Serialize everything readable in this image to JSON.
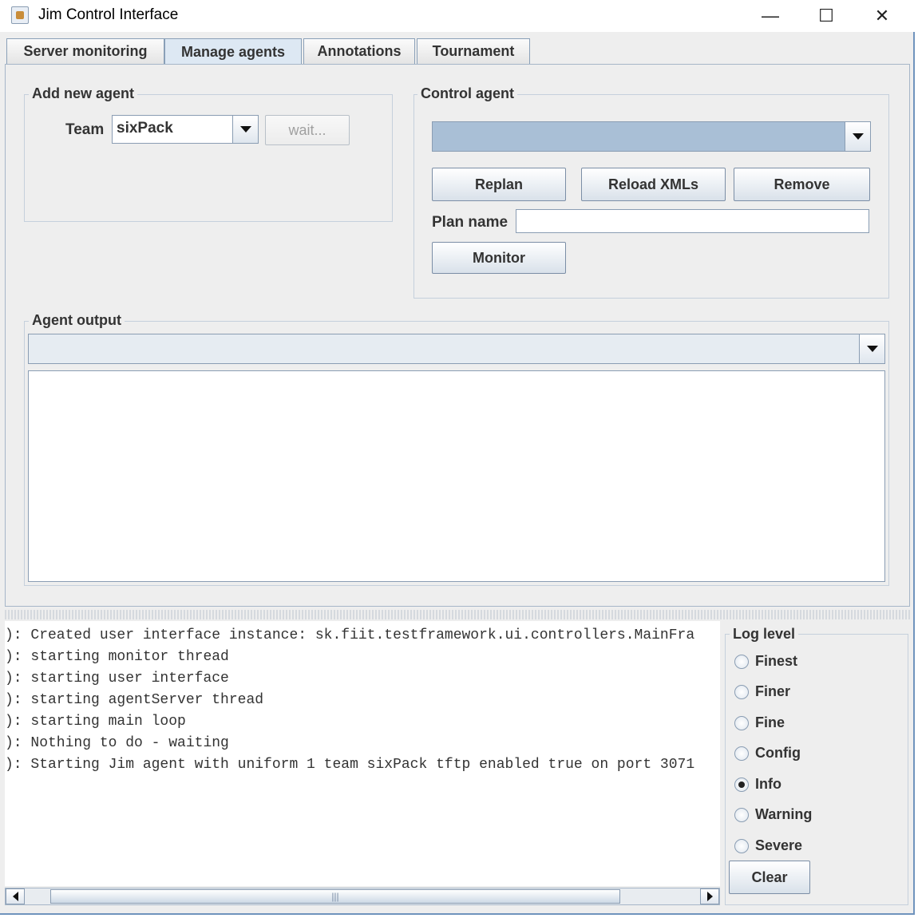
{
  "window": {
    "title": "Jim Control Interface",
    "minimize_glyph": "—",
    "maximize_glyph": "☐",
    "close_glyph": "✕"
  },
  "tabs": [
    {
      "label": "Server monitoring"
    },
    {
      "label": "Manage agents",
      "selected": true
    },
    {
      "label": "Annotations"
    },
    {
      "label": "Tournament"
    }
  ],
  "add_agent": {
    "legend": "Add new agent",
    "team_label": "Team",
    "team_value": "sixPack",
    "wait_button": "wait..."
  },
  "control_agent": {
    "legend": "Control agent",
    "agent_select_value": "",
    "replan_button": "Replan",
    "reload_button": "Reload XMLs",
    "remove_button": "Remove",
    "plan_name_label": "Plan name",
    "plan_name_value": "",
    "monitor_button": "Monitor"
  },
  "agent_output": {
    "legend": "Agent output",
    "select_value": "",
    "text": ""
  },
  "log": {
    "lines": [
      "): Created user interface instance: sk.fiit.testframework.ui.controllers.MainFra",
      "): starting monitor thread",
      "): starting user interface",
      "): starting agentServer thread",
      "): starting main loop",
      "): Nothing to do - waiting",
      "): Starting Jim agent with uniform 1 team sixPack tftp enabled true on port 3071"
    ],
    "scroll_thumb_glyph": "|||"
  },
  "log_level": {
    "legend": "Log level",
    "options": [
      "Finest",
      "Finer",
      "Fine",
      "Config",
      "Info",
      "Warning",
      "Severe"
    ],
    "selected": "Info",
    "clear_button": "Clear"
  },
  "colors": {
    "accent": "#6f93bd",
    "selected_tab": "#dde8f3",
    "combo_fill": "#a9bfd6"
  }
}
